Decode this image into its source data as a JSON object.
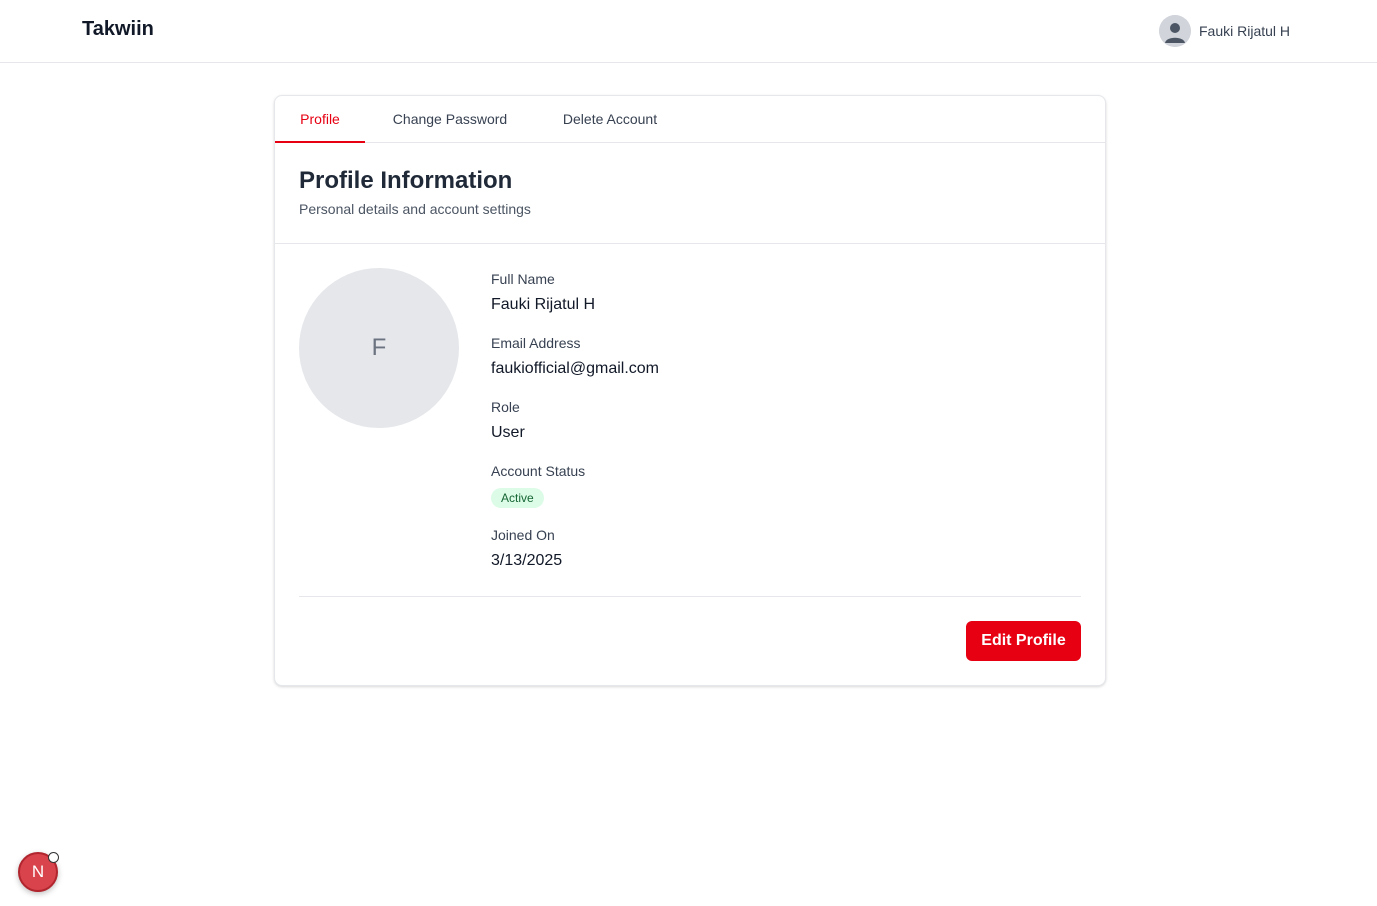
{
  "header": {
    "brand": "Takwiin",
    "user_name": "Fauki Rijatul H",
    "avatar_icon": "user-silhouette-icon"
  },
  "tabs": [
    {
      "label": "Profile",
      "active": true
    },
    {
      "label": "Change Password",
      "active": false
    },
    {
      "label": "Delete Account",
      "active": false
    }
  ],
  "profile": {
    "title": "Profile Information",
    "subtitle": "Personal details and account settings",
    "avatar_letter": "F",
    "fields": {
      "full_name": {
        "label": "Full Name",
        "value": "Fauki Rijatul H"
      },
      "email": {
        "label": "Email Address",
        "value": "faukiofficial@gmail.com"
      },
      "role": {
        "label": "Role",
        "value": "User"
      },
      "status": {
        "label": "Account Status",
        "value": "Active"
      },
      "joined": {
        "label": "Joined On",
        "value": "3/13/2025"
      }
    },
    "edit_button": "Edit Profile"
  },
  "dev_badge": {
    "letter": "N"
  },
  "colors": {
    "accent": "#e60012",
    "status_bg": "#dcfce7",
    "status_text": "#166534"
  }
}
